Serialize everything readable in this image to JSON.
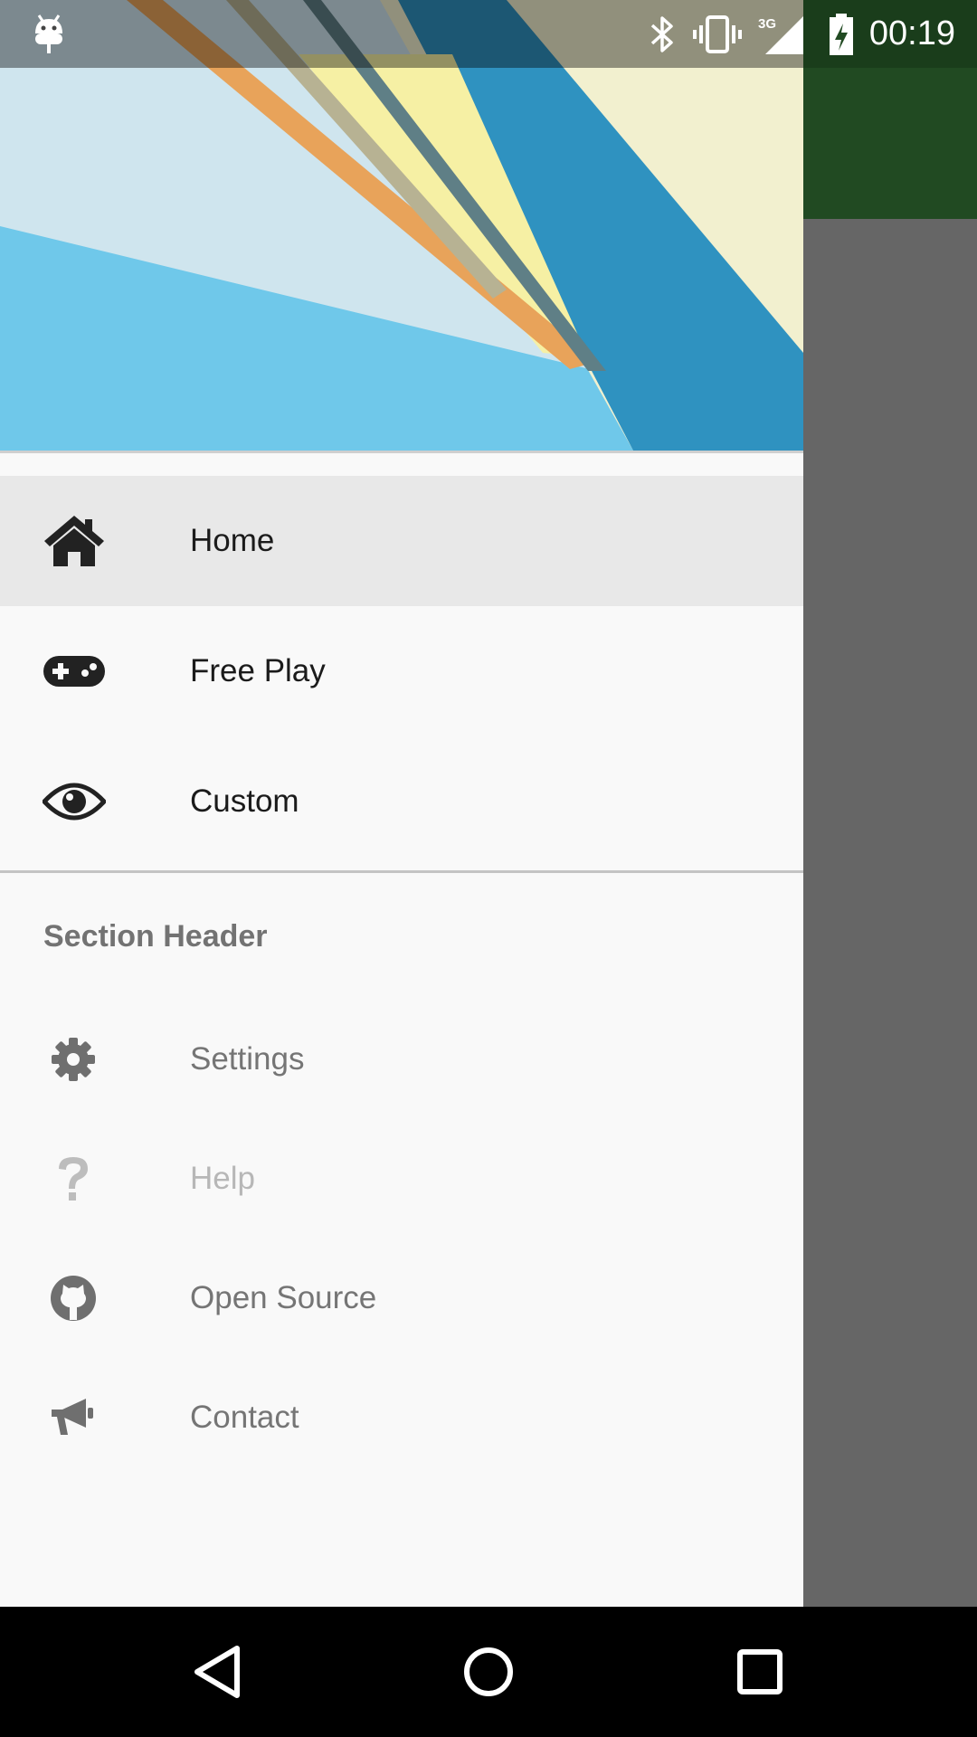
{
  "app": {
    "bar_color": "#214a22",
    "scrim_color": "#666666"
  },
  "status_bar": {
    "time": "00:19",
    "network": "3G",
    "icons": [
      "android-debug-icon",
      "bluetooth-icon",
      "vibrate-icon",
      "signal-icon",
      "battery-charging-icon"
    ]
  },
  "drawer": {
    "primary_items": [
      {
        "label": "Home",
        "icon": "home-icon",
        "selected": true
      },
      {
        "label": "Free Play",
        "icon": "gamepad-icon"
      },
      {
        "label": "Custom",
        "icon": "eye-icon"
      }
    ],
    "section_header": "Section Header",
    "secondary_items": [
      {
        "label": "Settings",
        "icon": "gear-icon"
      },
      {
        "label": "Help",
        "icon": "question-icon",
        "disabled": true
      },
      {
        "label": "Open Source",
        "icon": "github-icon"
      },
      {
        "label": "Contact",
        "icon": "megaphone-icon"
      }
    ]
  },
  "nav_bar": {
    "buttons": [
      "back-icon",
      "home-circle-icon",
      "recents-icon"
    ]
  }
}
